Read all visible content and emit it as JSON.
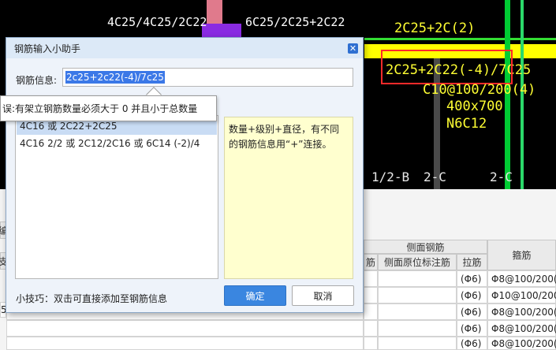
{
  "cad": {
    "top_left_text": "4C25/4C25/2C22",
    "top_mid_text": "6C25/2C25+2C22",
    "top_right_text": "2C25+2C(2)",
    "rebar_text": "2C25+2C22(-4)/7C25",
    "stirrup_text": "C10@100/200(4)",
    "section_text": "400x700",
    "side_text": "N6C12",
    "axis_labels": [
      "1/2-B",
      "2-C",
      "2-C"
    ]
  },
  "table": {
    "group_header": "侧面钢筋",
    "col_headers": [
      "筋",
      "侧面原位标注筋",
      "拉筋",
      "箍筋"
    ],
    "left_labels": [
      "编",
      "支",
      "5"
    ],
    "rows": [
      {
        "tie": "(Φ6)",
        "stirrup": "Φ8@100/200("
      },
      {
        "tie": "(Φ6)",
        "stirrup": "Φ10@100/200("
      },
      {
        "tie": "(Φ6)",
        "stirrup": "Φ8@100/200("
      },
      {
        "tie": "(Φ6)",
        "stirrup": "Φ8@100/200("
      },
      {
        "tie": "(Φ6)",
        "stirrup": "Φ8@100/200("
      }
    ]
  },
  "dialog": {
    "title": "钢筋输入小助手",
    "info_label": "钢筋信息:",
    "info_value": "2c25+2c22(-4)/7c25",
    "list_items": [
      "4C16 或 2C22+2C25",
      "4C16 2/2 或 2C12/2C16 或 6C14 (-2)/4"
    ],
    "hint": "数量+级别+直径，有不同的钢筋信息用“+”连接。",
    "tip": "小技巧：双击可直接添加至钢筋信息",
    "ok_label": "确定",
    "cancel_label": "取消",
    "close_icon": "close-icon"
  },
  "error_tooltip": "误:有架立钢筋数量必须大于 0 并且小于总数量"
}
